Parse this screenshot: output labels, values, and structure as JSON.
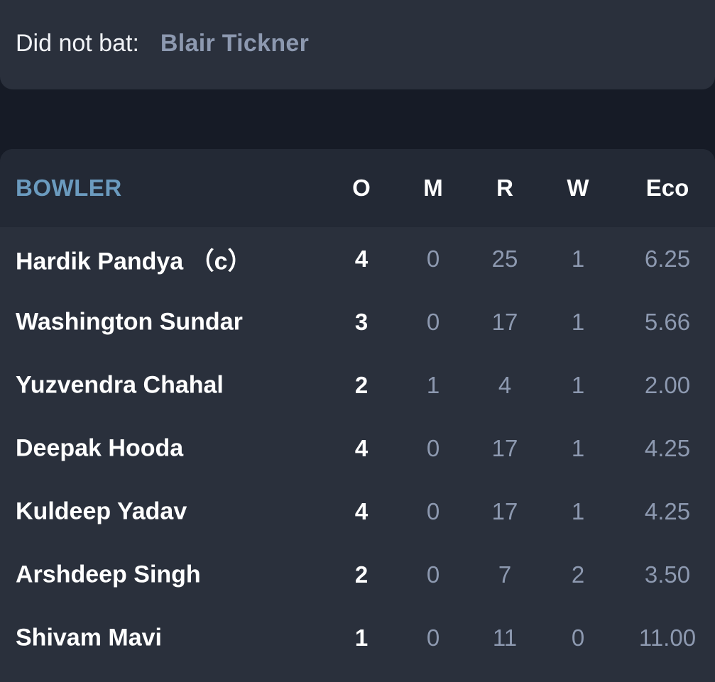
{
  "did_not_bat": {
    "label": "Did not bat:",
    "players": "Blair Tickner"
  },
  "bowling": {
    "headers": {
      "bowler": "BOWLER",
      "overs": "O",
      "maidens": "M",
      "runs": "R",
      "wickets": "W",
      "economy": "Eco"
    },
    "rows": [
      {
        "name": "Hardik Pandya （c）",
        "o": "4",
        "m": "0",
        "r": "25",
        "w": "1",
        "eco": "6.25"
      },
      {
        "name": "Washington Sundar",
        "o": "3",
        "m": "0",
        "r": "17",
        "w": "1",
        "eco": "5.66"
      },
      {
        "name": "Yuzvendra Chahal",
        "o": "2",
        "m": "1",
        "r": "4",
        "w": "1",
        "eco": "2.00"
      },
      {
        "name": "Deepak Hooda",
        "o": "4",
        "m": "0",
        "r": "17",
        "w": "1",
        "eco": "4.25"
      },
      {
        "name": "Kuldeep Yadav",
        "o": "4",
        "m": "0",
        "r": "17",
        "w": "1",
        "eco": "4.25"
      },
      {
        "name": "Arshdeep Singh",
        "o": "2",
        "m": "0",
        "r": "7",
        "w": "2",
        "eco": "3.50"
      },
      {
        "name": "Shivam Mavi",
        "o": "1",
        "m": "0",
        "r": "11",
        "w": "0",
        "eco": "11.00"
      }
    ]
  },
  "colors": {
    "card_bg": "#2a303c",
    "header_bg": "#232935",
    "page_bg": "#161b26",
    "accent": "#6b9bbf",
    "dim_text": "#8d99b0"
  }
}
